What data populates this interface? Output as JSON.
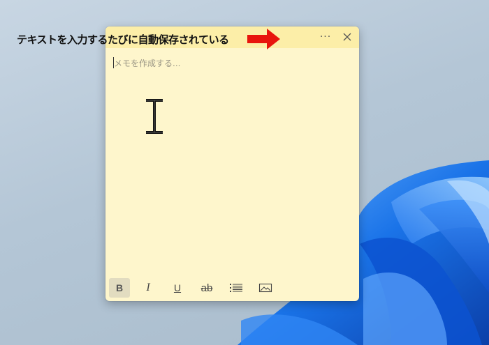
{
  "colors": {
    "note_background": "#fef6cc",
    "note_titlebar": "#fceea8",
    "annotation_arrow": "#e8150d"
  },
  "annotation": {
    "text": "テキストを入力するたびに自動保存されている"
  },
  "note": {
    "placeholder": "メモを作成する...",
    "titlebar": {
      "more_label": "···",
      "more_icon": "ellipsis-icon",
      "close_icon": "close-icon"
    },
    "toolbar": {
      "bold": "B",
      "italic": "I",
      "underline": "U",
      "strikethrough": "ab",
      "list_icon": "bullet-list-icon",
      "image_icon": "image-icon"
    }
  }
}
